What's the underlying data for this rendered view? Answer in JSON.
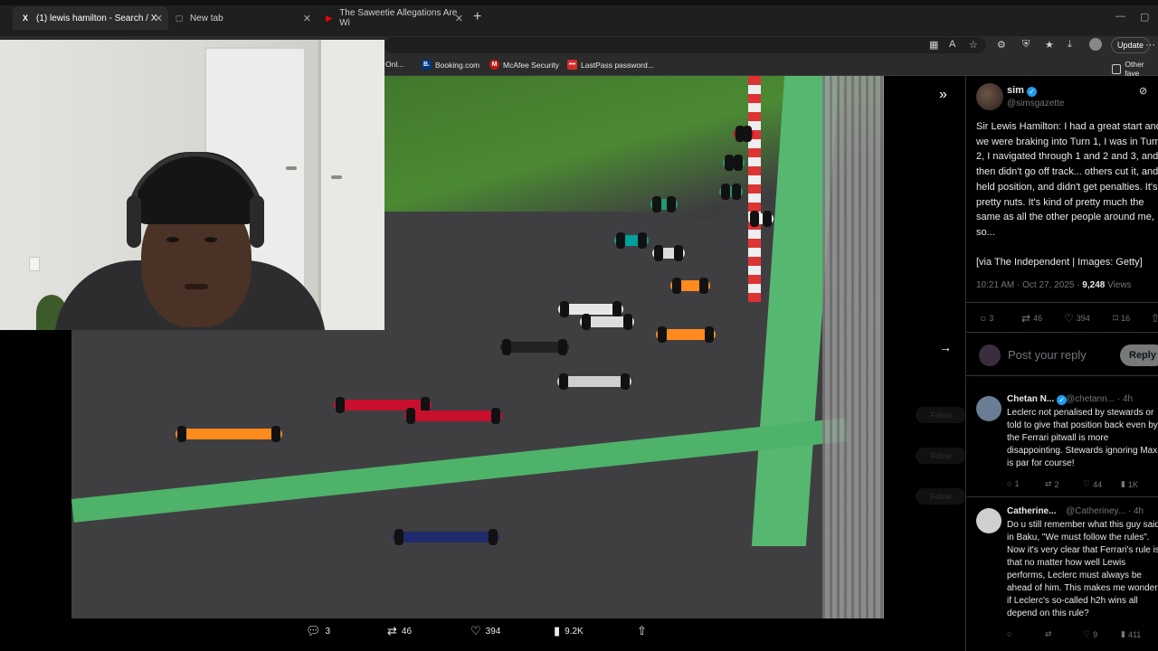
{
  "browser": {
    "tabs": [
      {
        "label": "(1) lewis hamilton - Search / X",
        "favicon": "X"
      },
      {
        "label": "New tab",
        "favicon": "▢"
      },
      {
        "label": "The Saweetie Allegations Are Wi",
        "favicon": "▶"
      }
    ],
    "new_tab_symbol": "+",
    "update_label": "Update",
    "bookmarks": [
      {
        "label": "Onl...",
        "icon_text": ""
      },
      {
        "label": "Booking.com",
        "icon_text": "B.",
        "color": "#003580"
      },
      {
        "label": "McAfee Security",
        "icon_text": "M",
        "color": "#c01818"
      },
      {
        "label": "LastPass password...",
        "icon_text": "•••",
        "color": "#d32d27"
      },
      {
        "label": "Other fave",
        "icon_text": ""
      }
    ]
  },
  "media": {
    "actions": {
      "replies": "3",
      "reposts": "46",
      "likes": "394",
      "views": "9.2K"
    }
  },
  "tweet": {
    "author_name": "sim",
    "author_handle": "@simsgazette",
    "text": "Sir Lewis Hamilton: I had a great start and we were braking into Turn 1, I was in Turn 2, I navigated through 1 and 2 and 3, and then didn't go off track... others cut it, and held position, and didn't get penalties. It's pretty nuts. It's kind of pretty much the same as all the other people around me, so...\n\n[via The Independent | Images: Getty]",
    "time": "10:21 AM · Oct 27, 2025 · ",
    "views_count": "9,248",
    "views_label": "Views",
    "stats": {
      "replies": "3",
      "reposts": "46",
      "likes": "394",
      "bookmarks": "16"
    },
    "reply_placeholder": "Post your reply",
    "reply_button": "Reply"
  },
  "replies": [
    {
      "name": "Chetan N...",
      "handle": "@chetann... · 4h",
      "text": "Leclerc not penalised by stewards or told to give that position back even by the Ferrari pitwall is more disappointing. Stewards ignoring Max is par for course!",
      "replies": "1",
      "reposts": "2",
      "likes": "44",
      "views": "1K"
    },
    {
      "name": "Catherine...",
      "handle": "@Catheriney... · 4h",
      "text": "Do u still remember what this guy said in Baku, \"We must follow the rules\". Now it's very clear that Ferrari's rule is that no matter how well Lewis performs, Leclerc must always be ahead of him. This makes me wonder if Leclerc's so-called h2h wins all depend on this rule?",
      "replies": "",
      "reposts": "",
      "likes": "9",
      "views": "411"
    }
  ],
  "ghost_buttons": [
    "Follow",
    "Follow",
    "Follow"
  ]
}
